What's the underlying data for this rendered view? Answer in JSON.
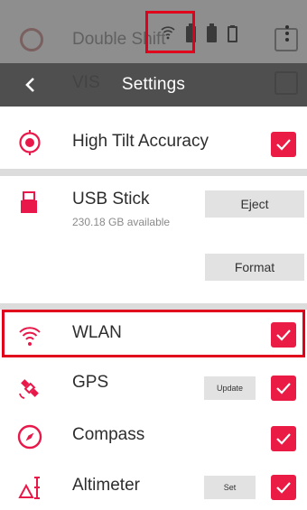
{
  "background_items": [
    {
      "label": "Double Shift",
      "icon": "dimmed-settings-icon"
    },
    {
      "label": "VIS",
      "icon": "dimmed-settings-icon"
    }
  ],
  "status_bar": {
    "icons": [
      "wifi-icon",
      "battery-icon",
      "battery-icon",
      "battery-outline-icon",
      "overflow-menu-icon"
    ]
  },
  "header": {
    "title": "Settings",
    "back_icon": "chevron-left-icon"
  },
  "settings": {
    "high_tilt": {
      "label": "High Tilt Accuracy",
      "checked": true,
      "icon": "tilt-target-icon"
    },
    "usb": {
      "label": "USB Stick",
      "subtitle": "230.18 GB available",
      "eject_label": "Eject",
      "format_label": "Format",
      "icon": "usb-stick-icon"
    },
    "wlan": {
      "label": "WLAN",
      "checked": true,
      "icon": "wifi-icon"
    },
    "gps": {
      "label": "GPS",
      "button_label": "Update",
      "checked": true,
      "icon": "satellite-icon"
    },
    "compass": {
      "label": "Compass",
      "checked": true,
      "icon": "compass-icon"
    },
    "altimeter": {
      "label": "Altimeter",
      "button_label": "Set",
      "checked": true,
      "icon": "altimeter-icon"
    }
  },
  "colors": {
    "accent": "#ea1c46",
    "icon_red": "#e8194a",
    "highlight_box": "#e0001b",
    "header_bg": "#4f4f4f",
    "status_bg": "#8e8e8e"
  }
}
